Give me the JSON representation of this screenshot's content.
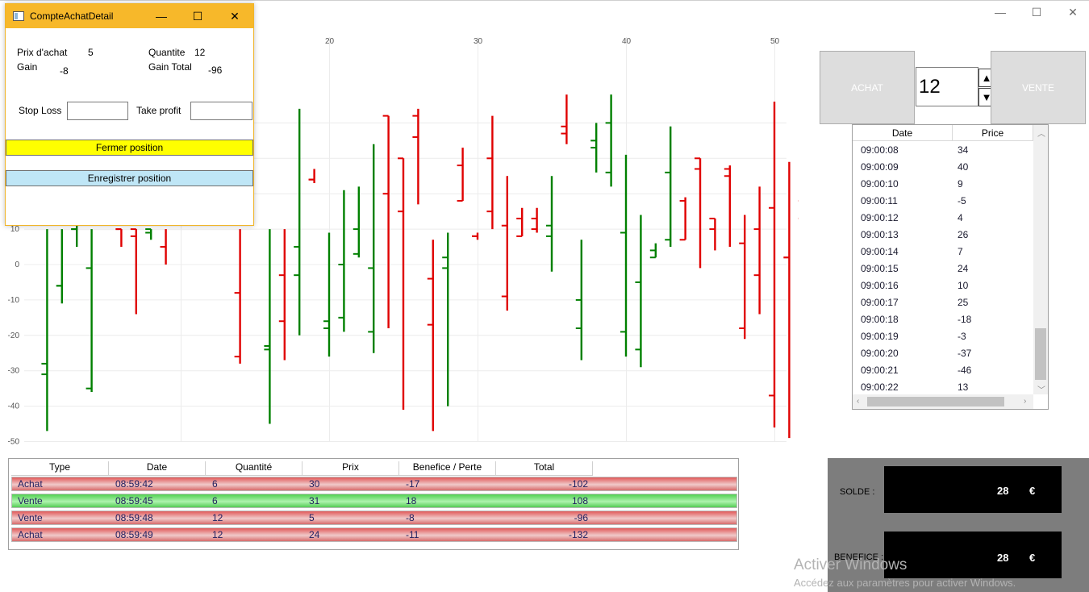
{
  "main_window": {
    "minimize_glyph": "—",
    "maximize_glyph": "☐",
    "close_glyph": "✕"
  },
  "dialog": {
    "title": "CompteAchatDetail",
    "prix_achat_label": "Prix d'achat",
    "prix_achat_value": "5",
    "quantite_label": "Quantite",
    "quantite_value": "12",
    "gain_label": "Gain",
    "gain_value": "-8",
    "gain_total_label": "Gain Total",
    "gain_total_value": "-96",
    "stop_loss_label": "Stop Loss",
    "stop_loss_value": "",
    "take_profit_label": "Take profit",
    "take_profit_value": "",
    "close_position_label": "Fermer position",
    "save_position_label": "Enregistrer position",
    "close_btn_color": "#ffff00",
    "save_btn_color": "#bfe6f6"
  },
  "trade_panel": {
    "buy_label": "ACHAT",
    "sell_label": "VENTE",
    "quantity": "12",
    "up_glyph": "▲",
    "down_glyph": "▼"
  },
  "ticks": {
    "headers": [
      "Date",
      "Price"
    ],
    "rows": [
      [
        "09:00:08",
        "34"
      ],
      [
        "09:00:09",
        "40"
      ],
      [
        "09:00:10",
        "9"
      ],
      [
        "09:00:11",
        "-5"
      ],
      [
        "09:00:12",
        "4"
      ],
      [
        "09:00:13",
        "26"
      ],
      [
        "09:00:14",
        "7"
      ],
      [
        "09:00:15",
        "24"
      ],
      [
        "09:00:16",
        "10"
      ],
      [
        "09:00:17",
        "25"
      ],
      [
        "09:00:18",
        "-18"
      ],
      [
        "09:00:19",
        "-3"
      ],
      [
        "09:00:20",
        "-37"
      ],
      [
        "09:00:21",
        "-46"
      ],
      [
        "09:00:22",
        "13"
      ]
    ]
  },
  "positions": {
    "headers": [
      "Type",
      "Date",
      "Quantité",
      "Prix",
      "Benefice / Perte",
      "Total"
    ],
    "rows": [
      {
        "type": "Achat",
        "date": "08:59:42",
        "qty": "6",
        "prix": "30",
        "pl": "-17",
        "total": "-102",
        "status": "loss"
      },
      {
        "type": "Vente",
        "date": "08:59:45",
        "qty": "6",
        "prix": "31",
        "pl": "18",
        "total": "108",
        "status": "gain"
      },
      {
        "type": "Vente",
        "date": "08:59:48",
        "qty": "12",
        "prix": "5",
        "pl": "-8",
        "total": "-96",
        "status": "loss"
      },
      {
        "type": "Achat",
        "date": "08:59:49",
        "qty": "12",
        "prix": "24",
        "pl": "-11",
        "total": "-132",
        "status": "loss"
      }
    ]
  },
  "balance": {
    "solde_label": "SOLDE :",
    "solde_value": "28",
    "benefice_label": "BENEFICE :",
    "benefice_value": "28",
    "currency": "€"
  },
  "watermark": {
    "line1": "Activer Windows",
    "line2": "Accédez aux paramètres pour activer Windows."
  },
  "chart_data": {
    "type": "ohlc",
    "x_ticks": [
      20,
      30,
      40,
      50
    ],
    "y_ticks": [
      10,
      0,
      -10,
      -20,
      -30,
      -40,
      -50
    ],
    "ylim": [
      -50,
      50
    ],
    "xlim": [
      0,
      50.5
    ],
    "grid": true,
    "colors": {
      "up": "#008000",
      "down": "#e00000"
    },
    "bars": [
      {
        "x": 1,
        "open": -28,
        "high": 10,
        "low": -47,
        "close": -31,
        "dir": "up"
      },
      {
        "x": 2,
        "open": -6,
        "high": 10,
        "low": -11,
        "close": -6,
        "dir": "up"
      },
      {
        "x": 3,
        "open": 10,
        "high": 11,
        "low": 5,
        "close": 10,
        "dir": "up"
      },
      {
        "x": 4,
        "open": -35,
        "high": 10,
        "low": -36,
        "close": -1,
        "dir": "up"
      },
      {
        "x": 6,
        "open": 10,
        "high": 10,
        "low": 5,
        "close": 10,
        "dir": "down"
      },
      {
        "x": 7,
        "open": 10,
        "high": 10,
        "low": -14,
        "close": 8,
        "dir": "down"
      },
      {
        "x": 8,
        "open": 10,
        "high": 10,
        "low": 7,
        "close": 9,
        "dir": "up"
      },
      {
        "x": 9,
        "open": 5,
        "high": 10,
        "low": 0,
        "close": 5,
        "dir": "down"
      },
      {
        "x": 14,
        "open": -8,
        "high": 10,
        "low": -28,
        "close": -26,
        "dir": "down"
      },
      {
        "x": 16,
        "open": -24,
        "high": 10,
        "low": -45,
        "close": -23,
        "dir": "up"
      },
      {
        "x": 17,
        "open": -3,
        "high": 10,
        "low": -27,
        "close": -16,
        "dir": "down"
      },
      {
        "x": 18,
        "open": -3,
        "high": 44,
        "low": -20,
        "close": 5,
        "dir": "up"
      },
      {
        "x": 19,
        "open": 24,
        "high": 27,
        "low": 23,
        "close": 24,
        "dir": "down"
      },
      {
        "x": 20,
        "open": -16,
        "high": 9,
        "low": -26,
        "close": -18,
        "dir": "up"
      },
      {
        "x": 21,
        "open": -15,
        "high": 21,
        "low": -19,
        "close": 0,
        "dir": "up"
      },
      {
        "x": 22,
        "open": 3,
        "high": 22,
        "low": 2,
        "close": 10,
        "dir": "up"
      },
      {
        "x": 23,
        "open": -19,
        "high": 34,
        "low": -25,
        "close": -1,
        "dir": "up"
      },
      {
        "x": 24,
        "open": 42,
        "high": 42,
        "low": -18,
        "close": 20,
        "dir": "down"
      },
      {
        "x": 25,
        "open": 30,
        "high": 30,
        "low": -41,
        "close": 15,
        "dir": "down"
      },
      {
        "x": 26,
        "open": 42,
        "high": 44,
        "low": 17,
        "close": 36,
        "dir": "down"
      },
      {
        "x": 27,
        "open": -4,
        "high": 7,
        "low": -47,
        "close": -17,
        "dir": "down"
      },
      {
        "x": 28,
        "open": -1,
        "high": 9,
        "low": -40,
        "close": 2,
        "dir": "up"
      },
      {
        "x": 29,
        "open": 28,
        "high": 33,
        "low": 18,
        "close": 18,
        "dir": "down"
      },
      {
        "x": 30,
        "open": 8,
        "high": 9,
        "low": 7,
        "close": 8,
        "dir": "down"
      },
      {
        "x": 31,
        "open": 30,
        "high": 42,
        "low": 10,
        "close": 15,
        "dir": "down"
      },
      {
        "x": 32,
        "open": 11,
        "high": 25,
        "low": -13,
        "close": -9,
        "dir": "down"
      },
      {
        "x": 33,
        "open": 13,
        "high": 16,
        "low": 8,
        "close": 8,
        "dir": "down"
      },
      {
        "x": 34,
        "open": 13,
        "high": 16,
        "low": 9,
        "close": 10,
        "dir": "down"
      },
      {
        "x": 35,
        "open": 11,
        "high": 25,
        "low": -2,
        "close": 8,
        "dir": "up"
      },
      {
        "x": 36,
        "open": 39,
        "high": 48,
        "low": 34,
        "close": 37,
        "dir": "down"
      },
      {
        "x": 37,
        "open": -18,
        "high": 7,
        "low": -27,
        "close": -10,
        "dir": "up"
      },
      {
        "x": 38,
        "open": 33,
        "high": 40,
        "low": 26,
        "close": 35,
        "dir": "up"
      },
      {
        "x": 39,
        "open": 26,
        "high": 48,
        "low": 22,
        "close": 40,
        "dir": "up"
      },
      {
        "x": 40,
        "open": -19,
        "high": 31,
        "low": -26,
        "close": 9,
        "dir": "up"
      },
      {
        "x": 41,
        "open": -24,
        "high": 14,
        "low": -29,
        "close": -5,
        "dir": "up"
      },
      {
        "x": 42,
        "open": 2,
        "high": 6,
        "low": 2,
        "close": 4,
        "dir": "up"
      },
      {
        "x": 43,
        "open": 7,
        "high": 39,
        "low": 5,
        "close": 26,
        "dir": "up"
      },
      {
        "x": 44,
        "open": 18,
        "high": 19,
        "low": 7,
        "close": 7,
        "dir": "down"
      },
      {
        "x": 45,
        "open": 30,
        "high": 30,
        "low": -1,
        "close": 27,
        "dir": "down"
      },
      {
        "x": 46,
        "open": 10,
        "high": 13,
        "low": 4,
        "close": 13,
        "dir": "down"
      },
      {
        "x": 47,
        "open": 25,
        "high": 28,
        "low": 5,
        "close": 27,
        "dir": "down"
      },
      {
        "x": 48,
        "open": -18,
        "high": 14,
        "low": -21,
        "close": 6,
        "dir": "down"
      },
      {
        "x": 49,
        "open": -3,
        "high": 22,
        "low": -14,
        "close": 10,
        "dir": "down"
      },
      {
        "x": 50,
        "open": -37,
        "high": 46,
        "low": -46,
        "close": 16,
        "dir": "down"
      },
      {
        "x": 51,
        "open": 2,
        "high": 29,
        "low": -49,
        "close": 2,
        "dir": "down"
      },
      {
        "x": 52,
        "open": 13,
        "high": 47,
        "low": -13,
        "close": 18,
        "dir": "down"
      }
    ]
  }
}
